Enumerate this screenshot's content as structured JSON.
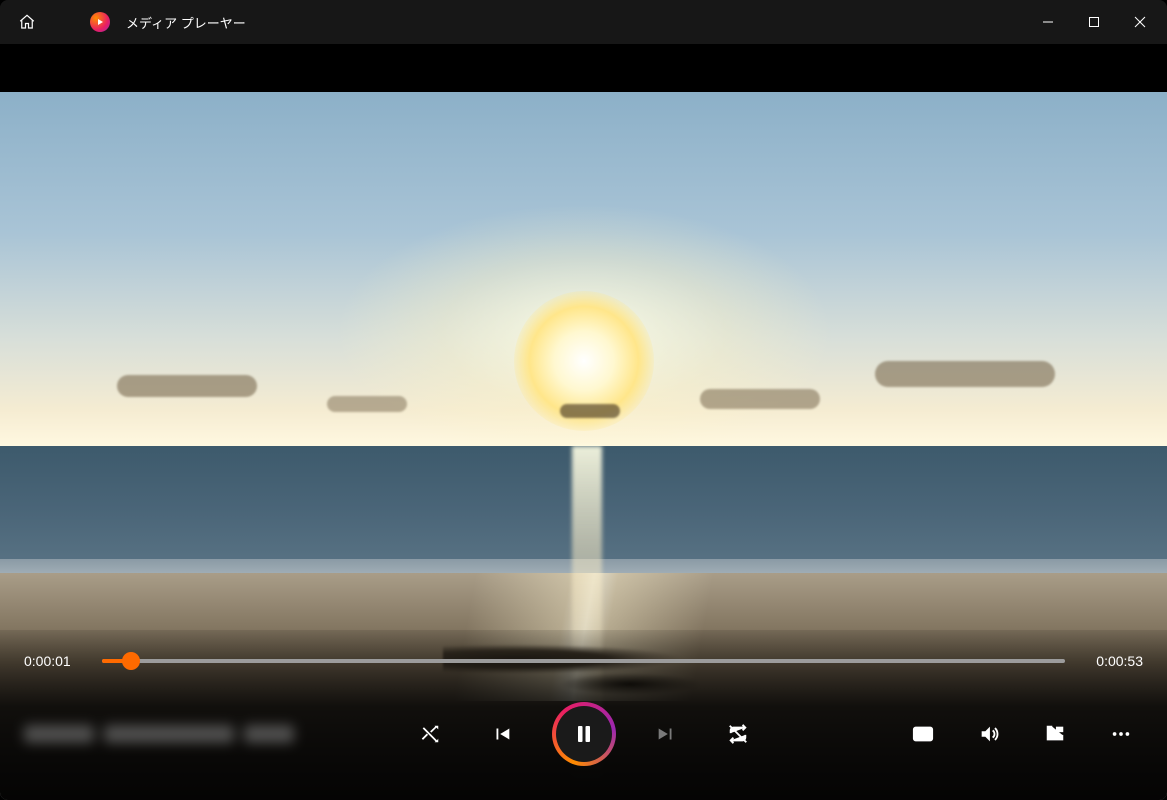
{
  "titlebar": {
    "app_name": "メディア プレーヤー"
  },
  "playback": {
    "current_time": "0:00:01",
    "total_time": "0:00:53",
    "progress_percent": 3
  },
  "icons": {
    "home": "home-icon",
    "minimize": "minimize-icon",
    "maximize": "maximize-icon",
    "close": "close-icon",
    "shuffle": "shuffle-icon",
    "previous": "skip-previous-icon",
    "pause": "pause-icon",
    "next": "skip-next-icon",
    "repeat": "repeat-off-icon",
    "subtitles": "subtitles-icon",
    "volume": "volume-icon",
    "miniplayer": "mini-player-icon",
    "more": "more-icon"
  },
  "colors": {
    "accent": "#ff6a00",
    "gradient_start": "#ff8c00",
    "gradient_mid": "#e91e63",
    "gradient_end": "#9c27b0"
  }
}
